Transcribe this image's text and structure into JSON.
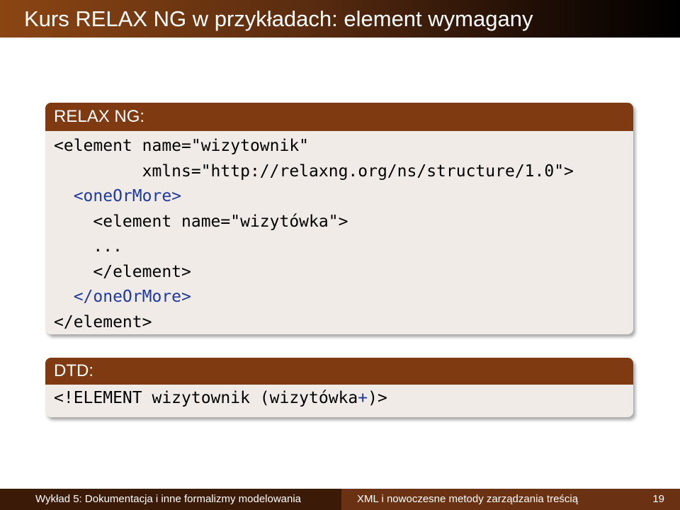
{
  "slide": {
    "title": "Kurs RELAX NG w przykładach: element wymagany"
  },
  "blocks": [
    {
      "header": "RELAX NG:",
      "lines": [
        "<element name=\"wizytownik\"",
        "         xmlns=\"http://relaxng.org/ns/structure/1.0\">",
        "  <oneOrMore>",
        "    <element name=\"wizytówka\">",
        "    ...",
        "    </element>",
        "  </oneOrMore>",
        "</element>"
      ]
    },
    {
      "header": "DTD:",
      "line_parts": [
        "<!ELEMENT wizytownik (wizytówka",
        "+",
        ")>"
      ]
    }
  ],
  "footer": {
    "left": "Wykład 5: Dokumentacja i inne formalizmy modelowania",
    "right": "XML i nowoczesne metody zarządzania treścią",
    "page": "19"
  },
  "colors": {
    "title_gradient_start": "#8b4513",
    "block_header": "#7f3a12",
    "block_body": "#f0ebe6",
    "keyword_blue": "#1f3a9e",
    "footer_left": "#3b1a08",
    "footer_right": "#6a3212"
  }
}
